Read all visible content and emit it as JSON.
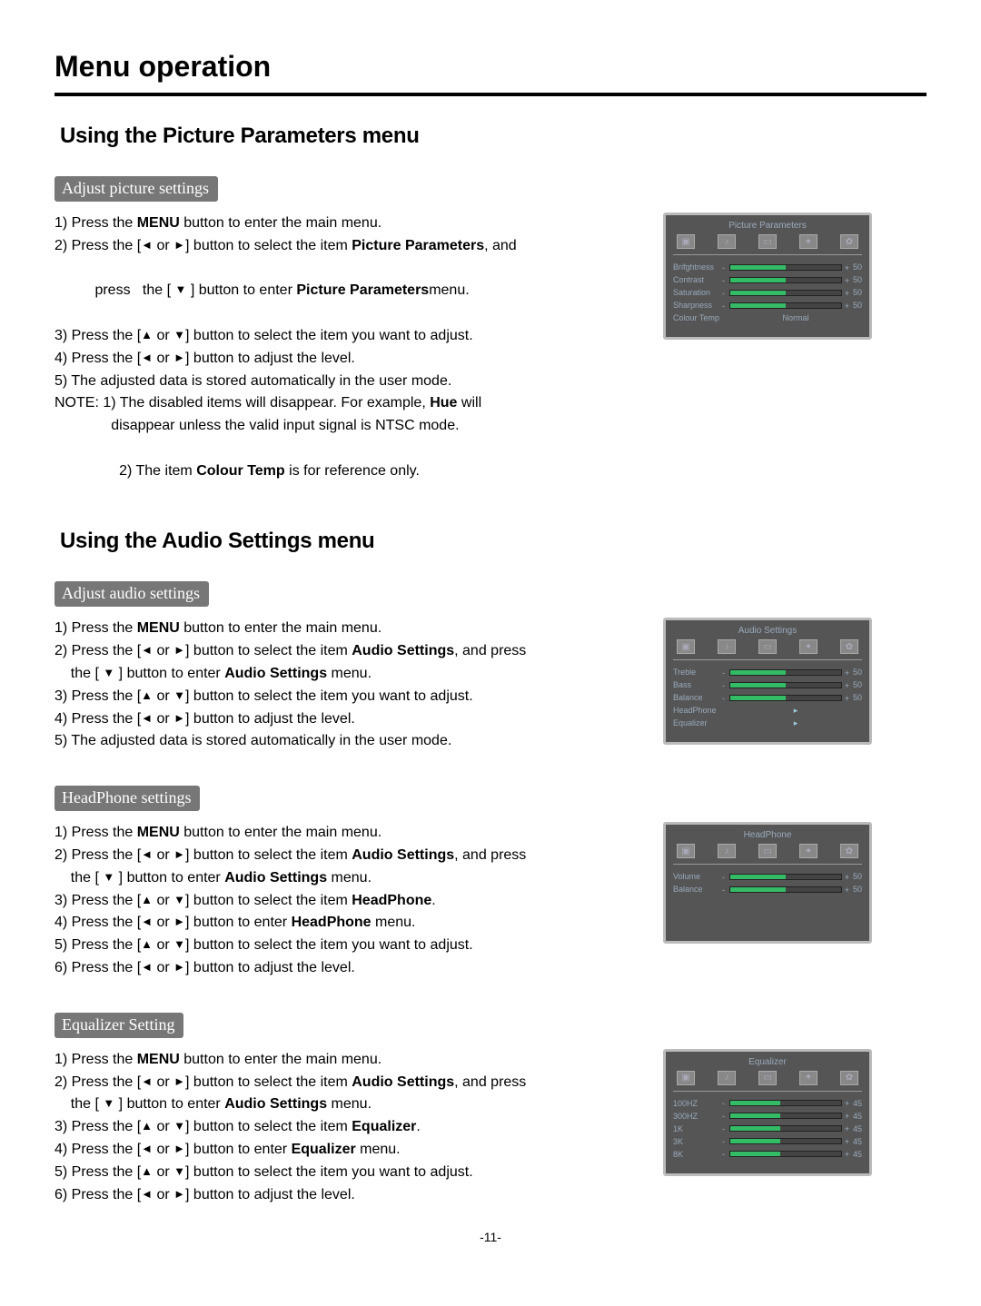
{
  "page_title": "Menu operation",
  "page_number": "-11-",
  "heading_picture": "Using the Picture Parameters  menu",
  "sub_adjust_picture": "Adjust picture settings",
  "pic_1_a": "1) Press the ",
  "pic_1_b": " button to enter the main menu.",
  "pic_2_a": "2) Press the [",
  "pic_2_b": " or ",
  "pic_2_c": "] button to select the item ",
  "pic_2_d": ", and",
  "pic_2e": "    press   the [ ",
  "pic_2f": " ] button to enter ",
  "pic_2g": "menu.",
  "pic_3_a": "3) Press the [",
  "pic_3_b": " or ",
  "pic_3_c": "]  button to select the item you want to adjust.",
  "pic_4_a": "4) Press the [",
  "pic_4_b": " or ",
  "pic_4_c": "]  button to adjust the level.",
  "pic_5": "5) The adjusted data is stored automatically in the user mode.",
  "pic_note1a": "NOTE: 1) The disabled items will disappear. For example, ",
  "pic_note1b": " will",
  "pic_note1c": "              disappear unless the valid input signal is NTSC mode.",
  "pic_note2a": "          2) The item ",
  "pic_note2b": " is for reference only.",
  "bold_menu": "MENU",
  "bold_picparam": "Picture Parameters",
  "bold_picparam2": "Picture Parameters",
  "bold_hue": "Hue",
  "bold_colourtemp": "Colour Temp",
  "heading_audio": "Using the Audio Settings  menu",
  "sub_adjust_audio": "Adjust audio settings",
  "aud_1_a": "1) Press the ",
  "aud_1_b": " button to enter the main menu.",
  "aud_2_a": "2) Press the [",
  "aud_2_b": " or ",
  "aud_2_c": "] button to select the item ",
  "aud_2_d": ", and press",
  "aud_2e": "    the [ ",
  "aud_2f": " ] button to enter ",
  "aud_2g": " menu.",
  "aud_3_a": "3) Press the [",
  "aud_3_b": " or ",
  "aud_3_c": "] button to select the item you want to adjust.",
  "aud_4_a": "4) Press the [",
  "aud_4_b": " or ",
  "aud_4_c": "] button to adjust the level.",
  "aud_5": "5) The adjusted data is stored automatically in the user mode.",
  "bold_audiosettings": "Audio Settings",
  "sub_headphone": "HeadPhone settings",
  "hp_1_a": "1) Press the ",
  "hp_1_b": " button to enter the main menu.",
  "hp_2_a": "2) Press the [",
  "hp_2_b": " or ",
  "hp_2_c": "] button to select the item ",
  "hp_2_d": ", and press",
  "hp_2e": "    the [ ",
  "hp_2f": " ] button to enter ",
  "hp_2g": " menu.",
  "hp_3_a": "3) Press the [",
  "hp_3_b": " or ",
  "hp_3_c": "] button to select the item ",
  "hp_3_d": ".",
  "hp_4_a": "4) Press the [",
  "hp_4_b": " or ",
  "hp_4_c": "] button to enter ",
  "hp_4_d": " menu.",
  "hp_5_a": "5) Press the [",
  "hp_5_b": " or ",
  "hp_5_c": "]  button to select the item you want to adjust.",
  "hp_6_a": "6) Press the [",
  "hp_6_b": " or ",
  "hp_6_c": "] button to adjust the level.",
  "bold_headphone": "HeadPhone",
  "sub_equalizer": "Equalizer Setting",
  "eq_1_a": "1) Press the ",
  "eq_1_b": " button to enter the main menu.",
  "eq_2_a": "2) Press the [",
  "eq_2_b": " or ",
  "eq_2_c": "] button to select the item ",
  "eq_2_d": ", and press",
  "eq_2e": "    the [ ",
  "eq_2f": " ] button to enter ",
  "eq_2g": " menu.",
  "eq_3_a": "3) Press the [",
  "eq_3_b": " or ",
  "eq_3_c": "] button to select the item ",
  "eq_3_d": ".",
  "eq_4_a": "4) Press the [",
  "eq_4_b": " or ",
  "eq_4_c": "] button to enter ",
  "eq_4_d": "  menu.",
  "eq_5_a": "5) Press the [",
  "eq_5_b": " or ",
  "eq_5_c": "]  button to select the item you want to adjust.",
  "eq_6_a": "6) Press the [",
  "eq_6_b": " or ",
  "eq_6_c": "] button to adjust the level.",
  "bold_equalizer": "Equalizer",
  "osd_pic": {
    "title": "Picture Parameters",
    "rows": [
      {
        "label": "Brifghtness",
        "val": "50",
        "pct": 50
      },
      {
        "label": "Contrast",
        "val": "50",
        "pct": 50
      },
      {
        "label": "Saturation",
        "val": "50",
        "pct": 50
      },
      {
        "label": "Sharpness",
        "val": "50",
        "pct": 50
      }
    ],
    "extra_label": "Colour Temp",
    "extra_value": "Normal"
  },
  "osd_audio": {
    "title": "Audio Settings",
    "rows": [
      {
        "label": "Treble",
        "val": "50",
        "pct": 50
      },
      {
        "label": "Bass",
        "val": "50",
        "pct": 50
      },
      {
        "label": "Balance",
        "val": "50",
        "pct": 50
      }
    ],
    "links": [
      {
        "label": "HeadPhone",
        "arrow": "▸"
      },
      {
        "label": "Equalizer",
        "arrow": "▸"
      }
    ]
  },
  "osd_hp": {
    "title": "HeadPhone",
    "rows": [
      {
        "label": "Volume",
        "val": "50",
        "pct": 50
      },
      {
        "label": "Balance",
        "val": "50",
        "pct": 50
      }
    ]
  },
  "osd_eq": {
    "title": "Equalizer",
    "rows": [
      {
        "label": "100HZ",
        "val": "45",
        "pct": 45
      },
      {
        "label": "300HZ",
        "val": "45",
        "pct": 45
      },
      {
        "label": "1K",
        "val": "45",
        "pct": 45
      },
      {
        "label": "3K",
        "val": "45",
        "pct": 45
      },
      {
        "label": "8K",
        "val": "45",
        "pct": 45
      }
    ]
  }
}
